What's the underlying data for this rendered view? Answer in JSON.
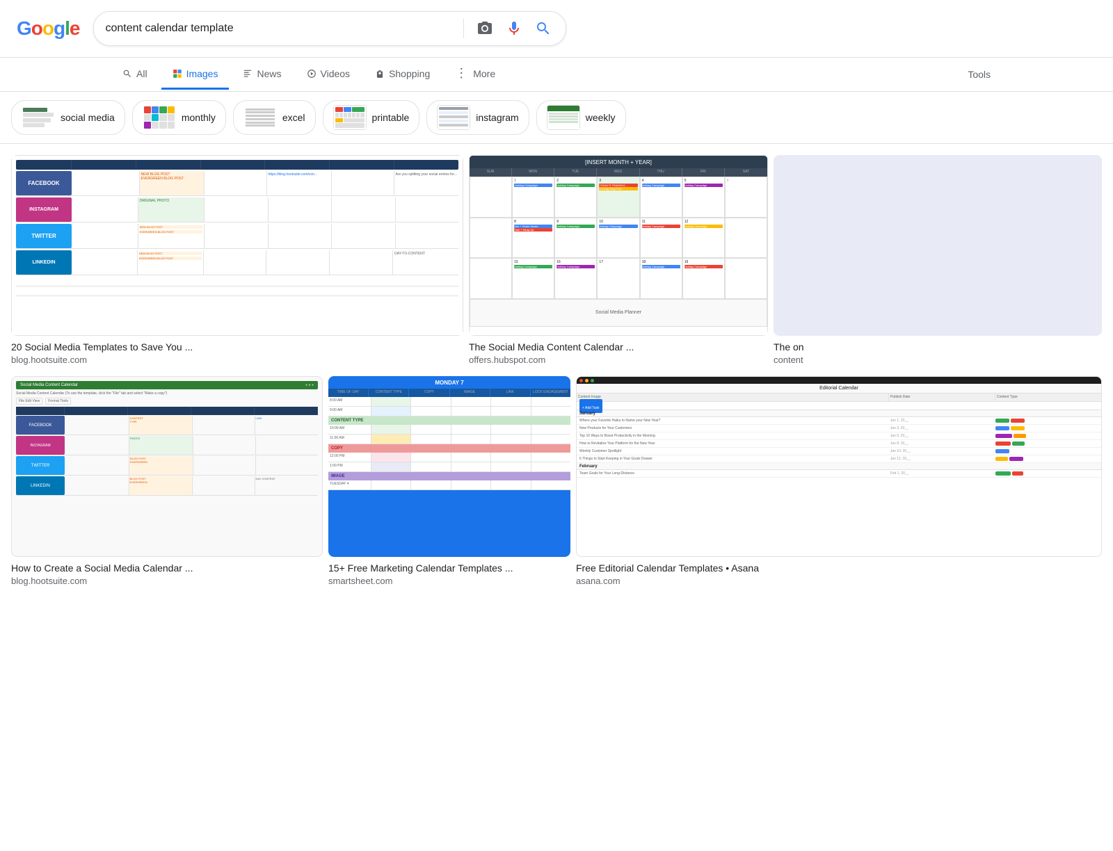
{
  "header": {
    "logo": "Google",
    "search_value": "content calendar template"
  },
  "nav": {
    "tabs": [
      {
        "id": "all",
        "label": "All",
        "icon": "search",
        "active": false
      },
      {
        "id": "images",
        "label": "Images",
        "icon": "image",
        "active": true
      },
      {
        "id": "news",
        "label": "News",
        "icon": "news",
        "active": false
      },
      {
        "id": "videos",
        "label": "Videos",
        "icon": "play",
        "active": false
      },
      {
        "id": "shopping",
        "label": "Shopping",
        "icon": "tag",
        "active": false
      },
      {
        "id": "more",
        "label": "More",
        "icon": "dots",
        "active": false
      }
    ],
    "tools_label": "Tools"
  },
  "filters": [
    {
      "id": "social-media",
      "label": "social media"
    },
    {
      "id": "monthly",
      "label": "monthly"
    },
    {
      "id": "excel",
      "label": "excel"
    },
    {
      "id": "printable",
      "label": "printable"
    },
    {
      "id": "instagram",
      "label": "instagram"
    },
    {
      "id": "weekly",
      "label": "weekly"
    }
  ],
  "results": {
    "row1": [
      {
        "id": "r1",
        "title": "20 Social Media Templates to Save You ...",
        "source": "blog.hootsuite.com",
        "type": "spreadsheet"
      },
      {
        "id": "r2",
        "title": "The Social Media Content Calendar ...",
        "source": "offers.hubspot.com",
        "type": "calendar"
      },
      {
        "id": "r3",
        "title": "The on",
        "source": "content",
        "type": "partial"
      }
    ],
    "row2": [
      {
        "id": "r4",
        "title": "How to Create a Social Media Calendar ...",
        "source": "blog.hootsuite.com",
        "type": "spreadsheet2"
      },
      {
        "id": "r5",
        "title": "15+ Free Marketing Calendar Templates ...",
        "source": "smartsheet.com",
        "type": "marketing"
      },
      {
        "id": "r6",
        "title": "Free Editorial Calendar Templates • Asana",
        "source": "asana.com",
        "type": "asana"
      }
    ]
  }
}
